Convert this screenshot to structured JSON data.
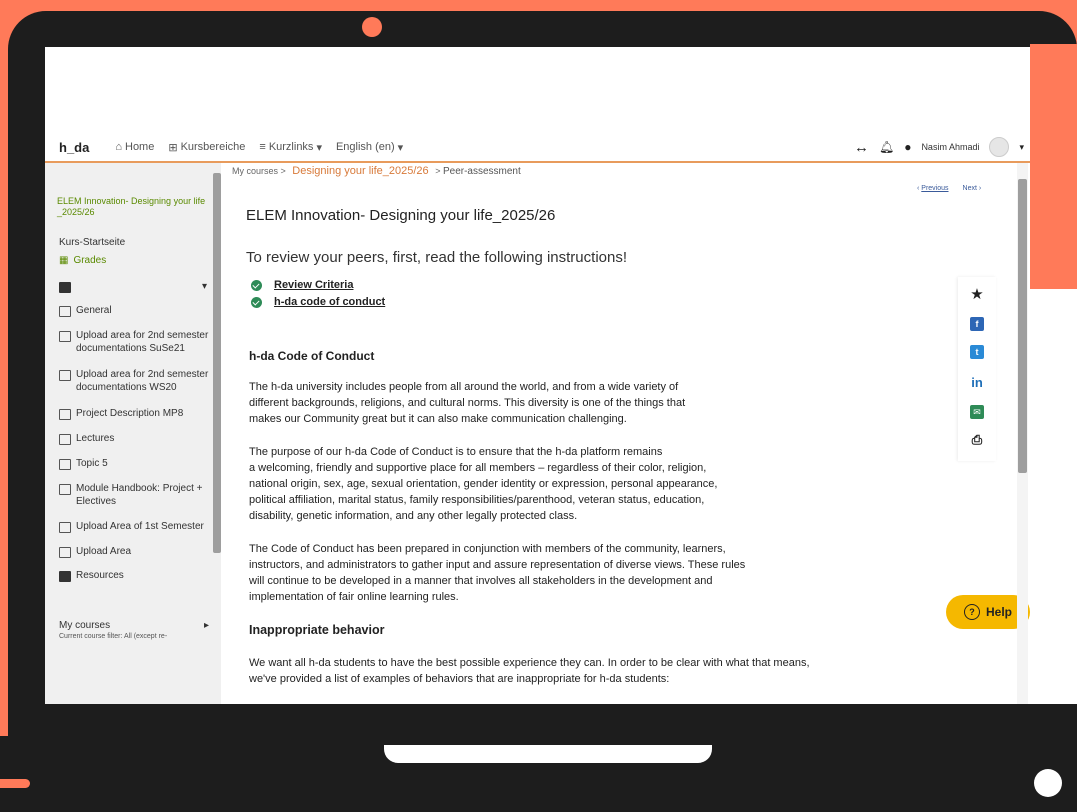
{
  "navbar": {
    "logo": "h_da",
    "home": "Home",
    "kursbereiche": "Kursbereiche",
    "kurzlinks": "Kurzlinks",
    "language": "English (en)",
    "user_name": "Nasim Ahmadi",
    "icons": [
      "expand-arrows-icon",
      "bell-icon",
      "chat-icon",
      "avatar",
      "chevron-down-icon"
    ]
  },
  "sidebar": {
    "course_title": "ELEM Innovation- Designing your life _2025/26",
    "items": [
      {
        "label": "Kurs-Startseite"
      },
      {
        "label": "Grades"
      },
      {
        "label": ""
      },
      {
        "label": "General"
      },
      {
        "label": "Upload area for 2nd semester documentations SuSe21"
      },
      {
        "label": "Upload area for 2nd semester documentations WS20"
      },
      {
        "label": "Project Description MP8"
      },
      {
        "label": "Lectures"
      },
      {
        "label": "Topic 5"
      },
      {
        "label": "Module Handbook: Project + Electives"
      },
      {
        "label": "Upload Area of 1st Semester"
      },
      {
        "label": "Upload Area"
      },
      {
        "label": "Resources"
      }
    ],
    "my_courses": "My courses",
    "filter": "Current course filter: All (except re-"
  },
  "main": {
    "breadcrumb": {
      "root": "My courses >",
      "current": "Designing your life_2025/26",
      "sep": ">",
      "last": "Peer-assessment"
    },
    "prev": "Previous",
    "next": "Next",
    "title": "ELEM Innovation- Designing your life_2025/26",
    "subtitle": "To review your peers, first, read the following instructions!",
    "links": [
      "Review Criteria",
      "h-da code of conduct"
    ],
    "coc_heading": "h-da Code of Conduct",
    "para1": [
      "The h-da university includes people from all around the world, and from a wide variety of",
      "different backgrounds, religions, and cultural norms. This diversity is one of the things that",
      " makes our Community great but it can also make communication challenging."
    ],
    "para2": [
      "The purpose of our h-da Code of Conduct is to ensure that the h-da platform remains",
      " a welcoming, friendly and supportive place for all members – regardless of their color, religion,",
      "national origin, sex, age, sexual orientation, gender identity or expression, personal appearance,",
      " political affiliation, marital status, family responsibilities/parenthood, veteran status, education,",
      " disability, genetic information, and any other legally protected class."
    ],
    "para3": [
      "The Code of Conduct has been prepared in conjunction with members of the community, learners,",
      "instructors, and administrators to gather input and assure representation of diverse views. These rules",
      "will continue to be developed in a manner that involves all stakeholders in the development and",
      " implementation of fair online learning rules."
    ],
    "inappropriate_heading": "Inappropriate behavior",
    "para4": [
      "We want all h-da students to have the best possible experience they can. In order to be clear with what that means,",
      "we've provided a list of examples of behaviors that are inappropriate for h-da students:"
    ],
    "help": "Help",
    "share_icons": [
      "star-icon",
      "facebook-icon",
      "twitter-icon",
      "linkedin-icon",
      "email-icon",
      "print-icon"
    ]
  },
  "colors": {
    "orange": "#ff7a59",
    "help": "#f5b800",
    "green": "#5a8a00",
    "link_orange": "#d87a3a"
  }
}
